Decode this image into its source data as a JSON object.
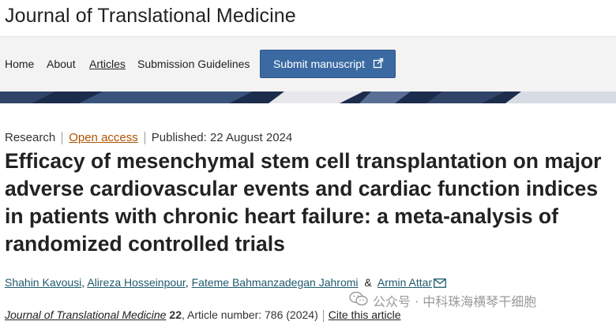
{
  "header": {
    "journal_title": "Journal of Translational Medicine"
  },
  "nav": {
    "items": [
      {
        "label": "Home"
      },
      {
        "label": "About"
      },
      {
        "label": "Articles"
      },
      {
        "label": "Submission Guidelines"
      }
    ],
    "submit_label": "Submit manuscript"
  },
  "article": {
    "type": "Research",
    "access": "Open access",
    "published": "Published: 22 August 2024",
    "title": "Efficacy of mesenchymal stem cell transplantation on major adverse cardiovascular events and cardiac function indices in patients with chronic heart failure: a meta-analysis of randomized controlled trials",
    "authors": [
      "Shahin Kavousi",
      "Alireza Hosseinpour",
      "Fateme Bahmanzadegan Jahromi",
      "Armin Attar"
    ],
    "comma": ",",
    "amp": "&",
    "citation": {
      "journal": "Journal of Translational Medicine",
      "volume": "22",
      "article_number": ", Article number: 786 (2024)",
      "cite_label": "Cite this article"
    }
  },
  "watermark": {
    "text": "公众号 · 中科珠海横琴干细胞"
  },
  "icons": {
    "external": "external-link-icon",
    "mail": "mail-icon",
    "wechat": "wechat-icon"
  },
  "colors": {
    "submit_bg": "#3b6aa3",
    "banner": "#1c2c4c",
    "open_access": "#b05300"
  }
}
